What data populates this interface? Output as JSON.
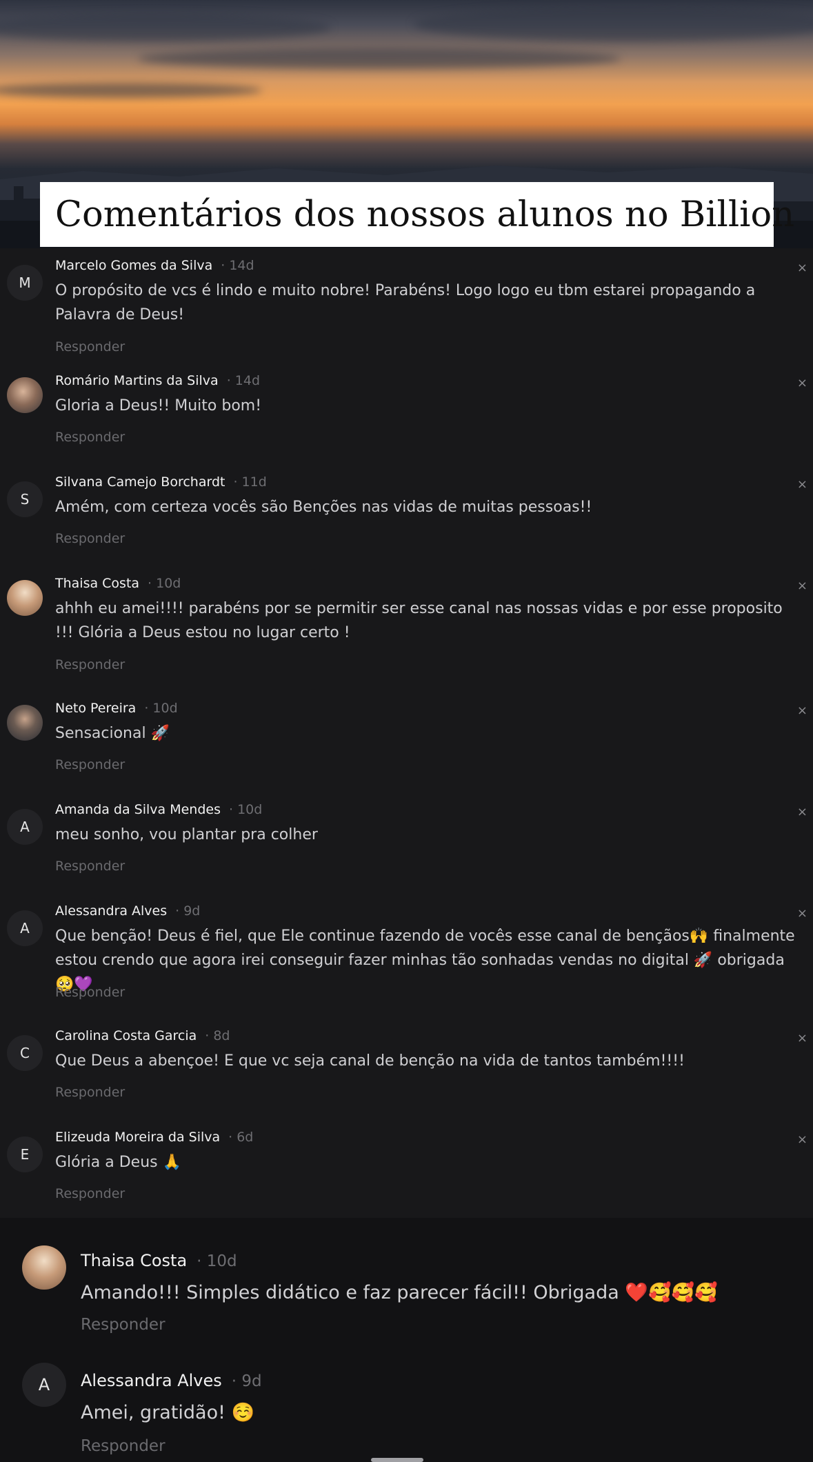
{
  "banner": {
    "title": "Comentários dos nossos alunos no Billion",
    "icon": "star-icon"
  },
  "reply_label": "Responder",
  "close_label": "×",
  "comments": [
    {
      "initial": "M",
      "name": "Marcelo Gomes da Silva",
      "time": "· 14d",
      "text": "O propósito de vcs é lindo e muito nobre! Parabéns! Logo logo eu tbm estarei propagando a Palavra de Deus!"
    },
    {
      "initial": "",
      "name": "Romário Martins da Silva",
      "time": "· 14d",
      "text": "Gloria a Deus!! Muito bom!"
    },
    {
      "initial": "S",
      "name": "Silvana Camejo Borchardt",
      "time": "· 11d",
      "text": "Amém, com certeza vocês são Benções nas vidas de muitas pessoas!!"
    },
    {
      "initial": "",
      "name": "Thaisa Costa",
      "time": "· 10d",
      "text": "ahhh eu amei!!!! parabéns por se permitir ser esse canal nas nossas vidas e por esse proposito !!! Glória a Deus estou no lugar certo !"
    },
    {
      "initial": "",
      "name": "Neto Pereira",
      "time": "· 10d",
      "text": "Sensacional 🚀"
    },
    {
      "initial": "A",
      "name": "Amanda da Silva Mendes",
      "time": "· 10d",
      "text": "meu sonho, vou plantar pra colher"
    },
    {
      "initial": "A",
      "name": "Alessandra Alves",
      "time": "· 9d",
      "text": "Que benção! Deus é fiel, que Ele continue fazendo de vocês esse canal de bençãos🙌 finalmente estou crendo que agora irei conseguir fazer minhas tão sonhadas vendas no digital 🚀 obrigada 🥺💜"
    },
    {
      "initial": "C",
      "name": "Carolina Costa Garcia",
      "time": "· 8d",
      "text": "Que Deus a abençoe! E que vc seja canal de benção na vida de tantos também!!!!"
    },
    {
      "initial": "E",
      "name": "Elizeuda Moreira da Silva",
      "time": "· 6d",
      "text": "Glória a Deus 🙏"
    }
  ],
  "panel_comments": [
    {
      "initial": "",
      "name": "Thaisa Costa",
      "time": "· 10d",
      "text": "Amando!!! Simples didático e faz parecer fácil!! Obrigada ❤️🥰🥰🥰"
    },
    {
      "initial": "A",
      "name": "Alessandra Alves",
      "time": "· 9d",
      "text": "Amei, gratidão! ☺️"
    }
  ]
}
